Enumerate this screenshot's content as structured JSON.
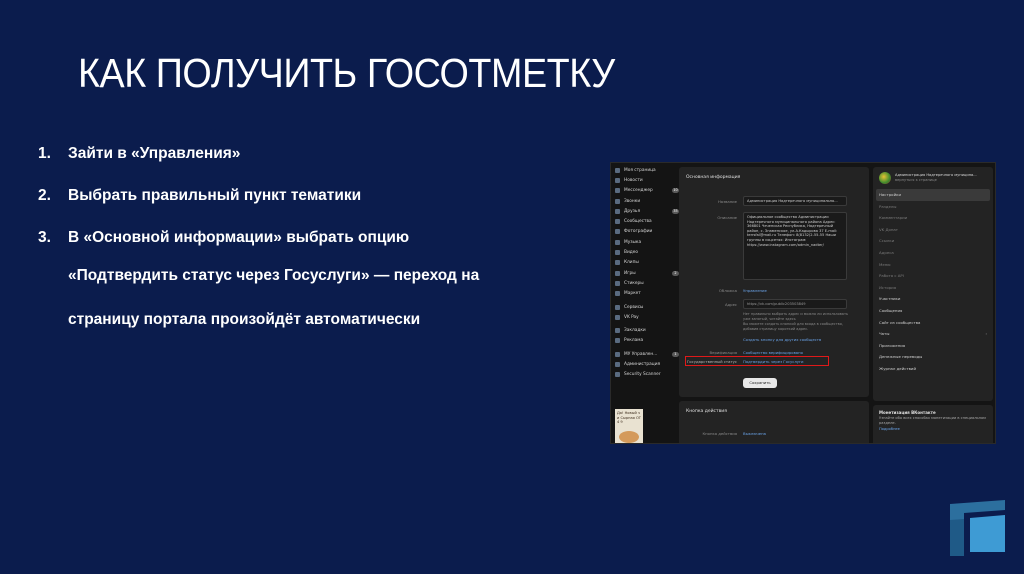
{
  "slide": {
    "title": "КАК ПОЛУЧИТЬ ГОСОТМЕТКУ",
    "steps": [
      {
        "num": "1.",
        "text": "Зайти в «Управления»"
      },
      {
        "num": "2.",
        "text": "Выбрать правильный пункт тематики"
      },
      {
        "num": "3.",
        "text": "В «Основной информации» выбрать опцию"
      }
    ],
    "step3_line2": "«Подтвердить статус через Госуслуги» — переход на",
    "step3_line3": "страницу портала произойдёт автоматически"
  },
  "screenshot": {
    "left_nav": [
      {
        "label": "Моя страница",
        "icon": "user-icon"
      },
      {
        "label": "Новости",
        "icon": "news-icon"
      },
      {
        "label": "Мессенджер",
        "icon": "chat-icon",
        "badge": "10"
      },
      {
        "label": "Звонки",
        "icon": "phone-icon"
      },
      {
        "label": "Друзья",
        "icon": "friends-icon",
        "badge": "35"
      },
      {
        "label": "Сообщества",
        "icon": "groups-icon"
      },
      {
        "label": "Фотографии",
        "icon": "photo-icon"
      },
      {
        "label": "Музыка",
        "icon": "music-icon"
      },
      {
        "label": "Видео",
        "icon": "video-icon"
      },
      {
        "label": "Клипы",
        "icon": "clips-icon"
      },
      {
        "label": "Игры",
        "icon": "games-icon",
        "badge": "2"
      },
      {
        "label": "Стикеры",
        "icon": "sticker-icon"
      },
      {
        "label": "Маркет",
        "icon": "market-icon"
      },
      {
        "label": "Сервисы",
        "icon": "services-icon"
      },
      {
        "label": "VK Pay",
        "icon": "pay-icon"
      },
      {
        "label": "Закладки",
        "icon": "bookmark-icon"
      },
      {
        "label": "Реклама",
        "icon": "ads-icon"
      },
      {
        "label": "МУ Управлен...",
        "icon": "group-icon",
        "badge": "1"
      },
      {
        "label": "Администрация",
        "icon": "admin-icon"
      },
      {
        "label": "Security Scanner",
        "icon": "shield-icon"
      }
    ],
    "promo_text": "Да! Новый ч и Сырная ОТ 4 9",
    "main": {
      "heading": "Основная информация",
      "name_label": "Название",
      "name_value": "Администрация Надтеречного муниципально...",
      "desc_label": "Описание",
      "desc_value": "Официальное сообщество Администрации Надтеречного муниципального района  Адрес: 366801 Чеченская Республика, Надтеречный район, с. Знаменское, ул.А.Кадырова 37 E-mail: terrsfal@mail.ru Телефон: 8(8132)2-55-55  Наши группы в соцсетях: Инстаграм: https://www.instagram.com/admin_nadter/",
      "cover_label": "Обложка",
      "cover_value": "Управление",
      "addr_label": "Адрес",
      "addr_value": "https://vk.com/public203503849",
      "addr_note": "Нет правильно выбрать адрес и можно ли использовать уже занятый, читайте здесь",
      "addr_note2": "Вы можете создать кнопкой для входа в сообщество, добавив страницу короткий адрес.",
      "addr_link": "Создать кнопку для других сообществ",
      "verif_label": "Верификация",
      "verif_value": "Сообщество верифицировано",
      "gos_label": "Государственный статус",
      "gos_value": "Подтвердить через Госуслуги",
      "save_label": "Сохранить"
    },
    "actions": {
      "heading": "Кнопка действия",
      "label": "Кнопка действия",
      "value": "Выключена"
    },
    "right_panel": {
      "name": "Администрация Надтеречного муниципа...",
      "sub": "вернуться к странице",
      "items": [
        {
          "label": "Настройки",
          "state": "active"
        },
        {
          "label": "Разделы",
          "state": "dim"
        },
        {
          "label": "Комментарии",
          "state": "dim"
        },
        {
          "label": "VK Донат",
          "state": "dim"
        },
        {
          "label": "Ссылки",
          "state": "dim"
        },
        {
          "label": "Адреса",
          "state": "dim"
        },
        {
          "label": "Меню",
          "state": "dim"
        },
        {
          "label": "Работа с API",
          "state": "dim"
        },
        {
          "label": "История",
          "state": "dim"
        },
        {
          "label": "Участники",
          "state": "normal"
        },
        {
          "label": "Сообщения",
          "state": "normal"
        },
        {
          "label": "Сайт из сообщества",
          "state": "normal"
        },
        {
          "label": "Чаты",
          "state": "normal",
          "arrow": true
        },
        {
          "label": "Приложения",
          "state": "normal"
        },
        {
          "label": "Денежные переводы",
          "state": "normal"
        },
        {
          "label": "Журнал действий",
          "state": "normal"
        }
      ],
      "monetize_title": "Монетизация ВКонтакте",
      "monetize_text": "Узнайте обо всех способах монетизации в специальном разделе.",
      "monetize_link": "Подробнее"
    }
  },
  "colors": {
    "background": "#0b1c4d",
    "highlight": "#e01919",
    "link": "#6aa3e8"
  }
}
